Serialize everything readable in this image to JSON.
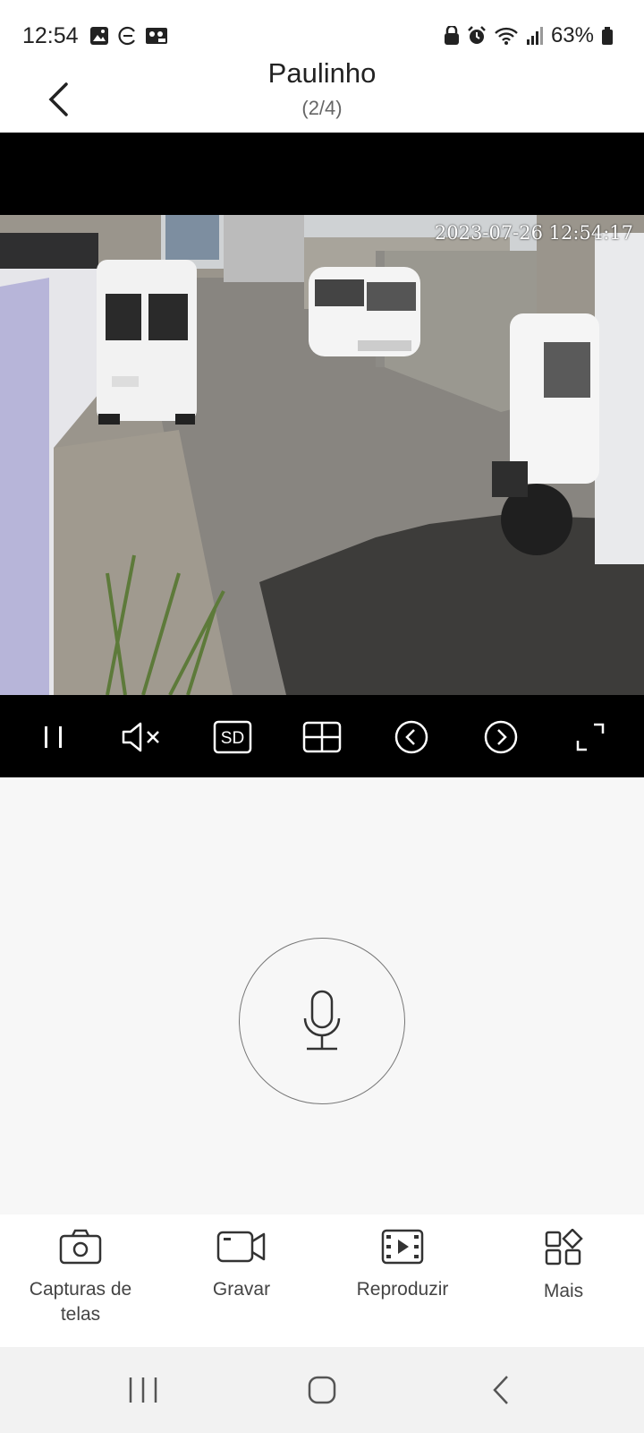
{
  "status_bar": {
    "time": "12:54",
    "battery": "63%",
    "left_icons": [
      "gallery-icon",
      "sync-icon",
      "voicemail-icon"
    ],
    "right_icons": [
      "lock-icon",
      "alarm-icon",
      "wifi-icon",
      "signal-icon",
      "battery-icon"
    ]
  },
  "header": {
    "title": "Paulinho",
    "subtitle": "(2/4)",
    "back_icon": "chevron-left-icon"
  },
  "video": {
    "timestamp": "2023-07-26  12:54:17",
    "controls": [
      "pause-icon",
      "mute-icon",
      "sd-quality-button",
      "grid-layout-icon",
      "previous-camera-icon",
      "next-camera-icon",
      "fullscreen-icon"
    ],
    "sd_label": "SD"
  },
  "talk": {
    "icon": "microphone-icon"
  },
  "toolbar": {
    "items": [
      {
        "label": "Capturas de telas",
        "icon": "camera-icon"
      },
      {
        "label": "Gravar",
        "icon": "video-camera-icon"
      },
      {
        "label": "Reproduzir",
        "icon": "film-play-icon"
      },
      {
        "label": "Mais",
        "icon": "apps-grid-icon"
      }
    ]
  },
  "nav": {
    "buttons": [
      "recents-icon",
      "home-icon",
      "back-icon"
    ]
  },
  "colors": {
    "video_bg": "#000000",
    "page_bg": "#f7f7f7",
    "toolbar_bg": "#ffffff"
  }
}
